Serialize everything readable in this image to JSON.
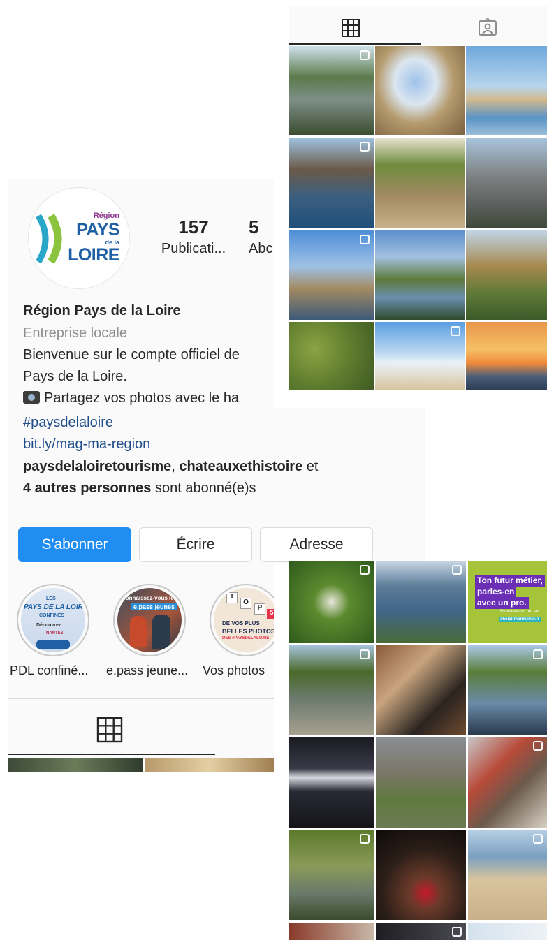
{
  "profile": {
    "logo": {
      "region": "Région",
      "pays": "PAYS",
      "de_la": "de la",
      "loire": "LOIRE"
    },
    "stats": {
      "posts_count": "157",
      "posts_label": "Publicati...",
      "followers_count": "5",
      "followers_label": "Abc"
    },
    "name": "Région Pays de la Loire",
    "category": "Entreprise locale",
    "bio_line1": "Bienvenue sur le compte officiel de",
    "bio_line2": "Pays de la Loire.",
    "bio_line3": "Partagez vos photos avec le ha",
    "hashtag": "#paysdelaloire",
    "link": "bit.ly/mag-ma-region",
    "followed_by": {
      "user1": "paysdelaloiretourisme",
      "sep": ", ",
      "user2": "chateauxethistoire",
      "and": " et",
      "others": "4 autres personnes",
      "suffix": " sont abonné(e)s"
    },
    "buttons": {
      "follow": "S'abonner",
      "message": "Écrire",
      "address": "Adresse"
    },
    "highlights": [
      {
        "label": "PDL confiné...",
        "l1": "LES",
        "l2": "PAYS DE LA LOIRE",
        "l3": "CONFINÉS",
        "l4": "Découvrez",
        "l5": "NANTES"
      },
      {
        "label": "e.pass jeune...",
        "l1": "Connaissez-vous le",
        "l2": "e.pass jeunes"
      },
      {
        "label": "Vos photos",
        "l1": "DE VOS PLUS",
        "l2": "BELLES PHOTOS",
        "l3": "DES #PAYSDELALOIRE"
      }
    ]
  },
  "grid_top": {
    "tabs": [
      "grid-icon",
      "tagged-icon"
    ]
  },
  "grid_bottom": {
    "promo": {
      "line1": "Ton futur métier,",
      "line2": "parles-en",
      "line3": "avec un pro.",
      "line4": "Rencontre un pro sur",
      "line5": "choisirmonmetier.fr"
    }
  },
  "colors": {
    "follow_button": "#1f8df2",
    "link": "#1f4c8a",
    "logo_blue": "#1f5fa3",
    "logo_green": "#8bc53f",
    "logo_cyan": "#2aa6c9"
  }
}
